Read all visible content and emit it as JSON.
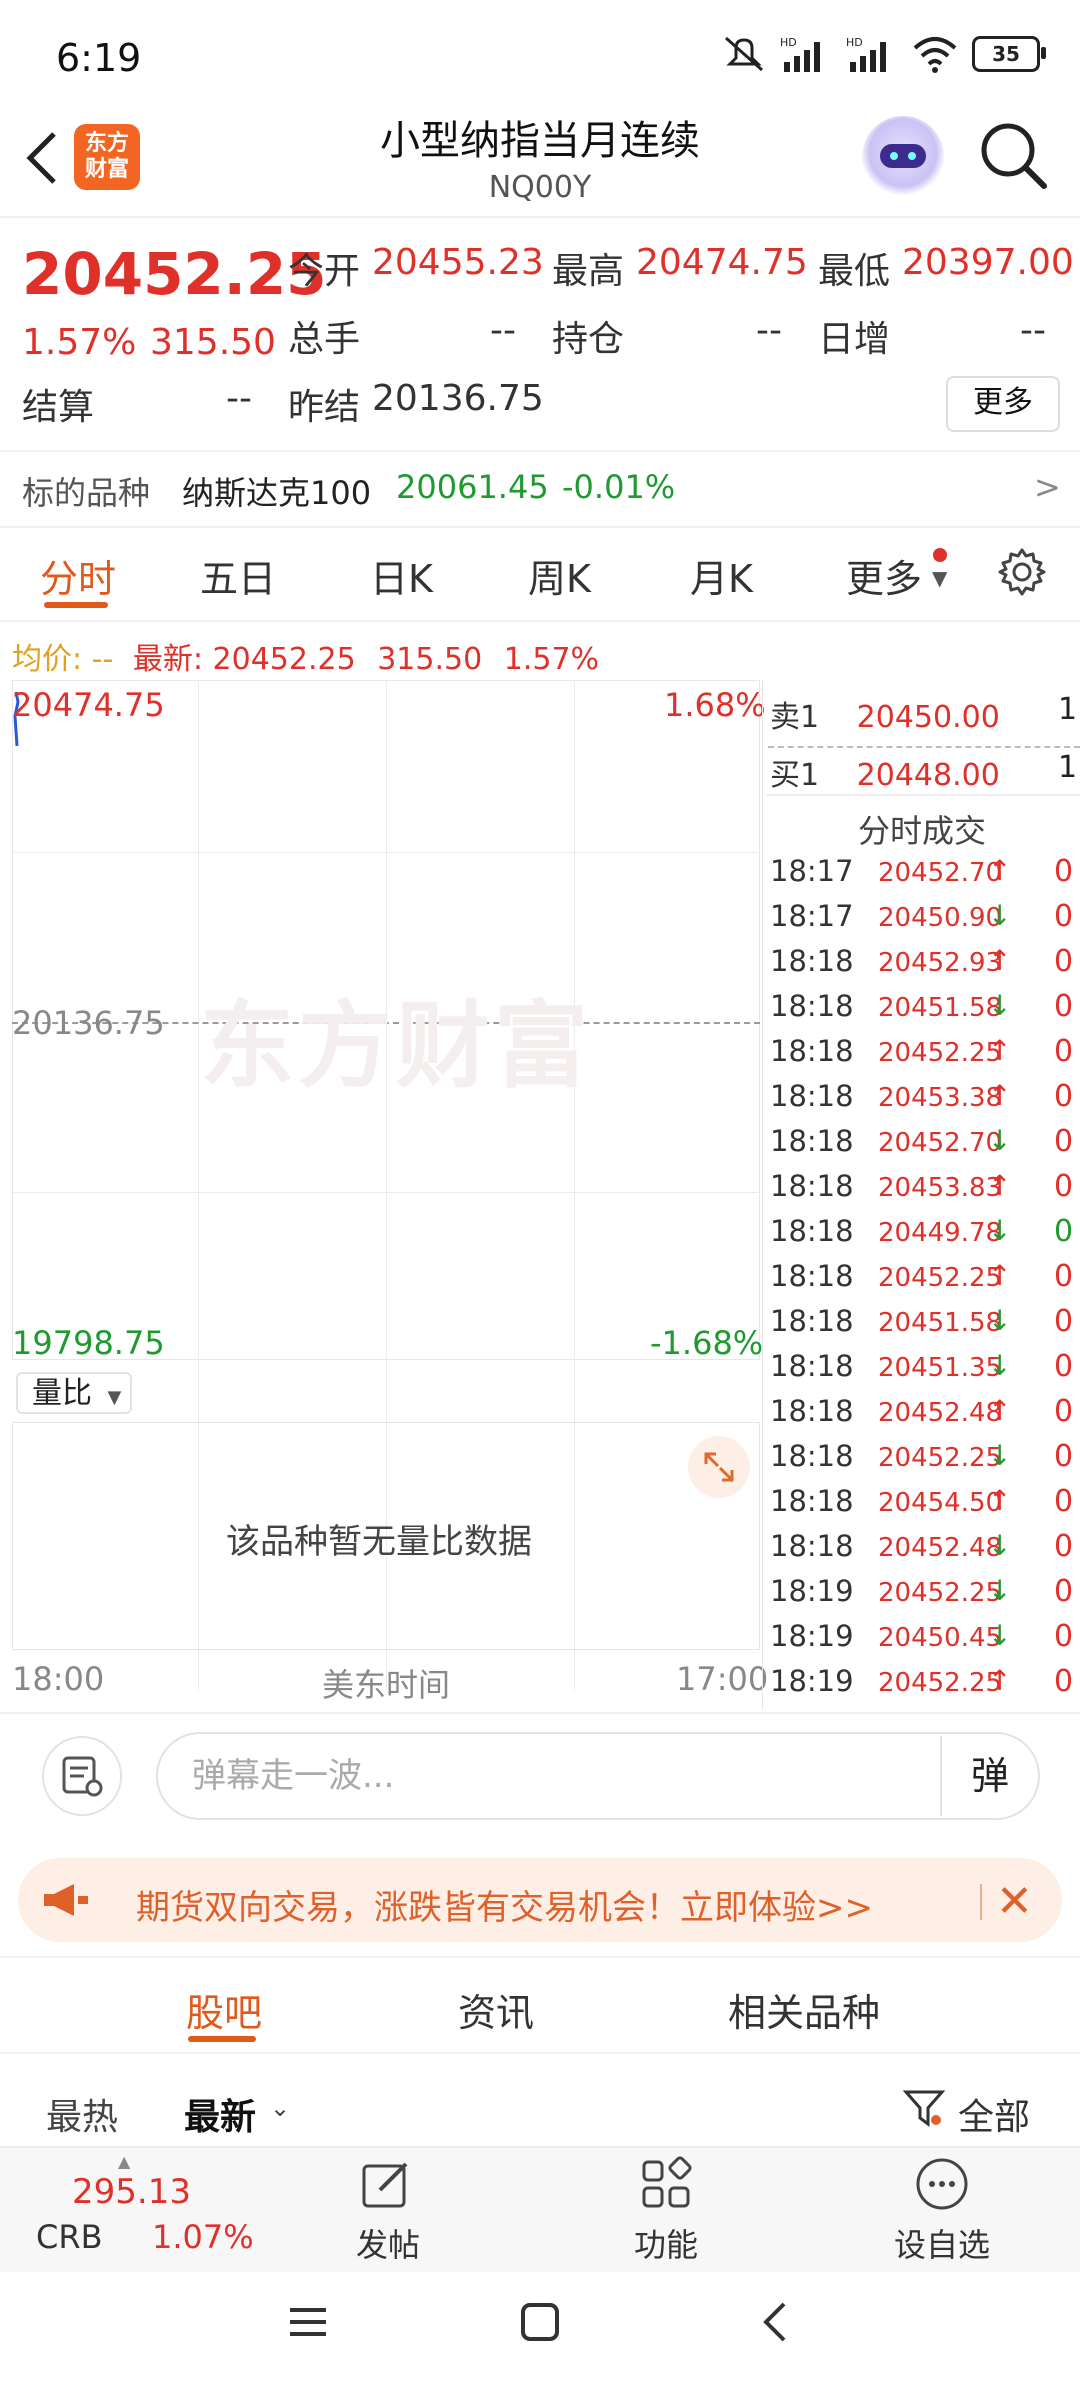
{
  "status": {
    "time": "6:19",
    "battery": "35"
  },
  "header": {
    "title": "小型纳指当月连续",
    "code": "NQ00Y",
    "logo_line1": "东方",
    "logo_line2": "财富"
  },
  "quote": {
    "price": "20452.25",
    "pct": "1.57%",
    "change": "315.50",
    "open_label": "今开",
    "open": "20455.23",
    "high_label": "最高",
    "high": "20474.75",
    "low_label": "最低",
    "low": "20397.00",
    "volume_label": "总手",
    "volume": "--",
    "oi_label": "持仓",
    "oi": "--",
    "daily_inc_label": "日增",
    "daily_inc": "--",
    "settle_label": "结算",
    "settle": "--",
    "prev_settle_label": "昨结",
    "prev_settle": "20136.75",
    "more_label": "更多"
  },
  "underlying": {
    "label": "标的品种",
    "name": "纳斯达克100",
    "price": "20061.45",
    "pct": "-0.01%",
    "arrow": ">"
  },
  "tabs": [
    "分时",
    "五日",
    "日K",
    "周K",
    "月K",
    "更多"
  ],
  "avg": {
    "avg_label": "均价:",
    "avg_val": "--",
    "latest_label": "最新:",
    "latest": "20452.25",
    "change": "315.50",
    "pct": "1.57%"
  },
  "chart": {
    "high": "20474.75",
    "high_pct": "1.68%",
    "mid": "20136.75",
    "low": "19798.75",
    "low_pct": "-1.68%",
    "watermark": "东方财富",
    "start_time": "18:00",
    "mid_time": "美东时间",
    "end_time": "17:00",
    "volume_select": "量比",
    "no_data": "该品种暂无量比数据"
  },
  "orderbook": {
    "sell_label": "卖1",
    "sell_price": "20450.00",
    "sell_vol": "1",
    "buy_label": "买1",
    "buy_price": "20448.00",
    "buy_vol": "1",
    "trades_title": "分时成交"
  },
  "trades": [
    {
      "time": "18:17",
      "price": "20452.70",
      "dir": "up",
      "vol": "0"
    },
    {
      "time": "18:17",
      "price": "20450.90",
      "dir": "down",
      "vol": "0"
    },
    {
      "time": "18:18",
      "price": "20452.93",
      "dir": "up",
      "vol": "0"
    },
    {
      "time": "18:18",
      "price": "20451.58",
      "dir": "down",
      "vol": "0"
    },
    {
      "time": "18:18",
      "price": "20452.25",
      "dir": "up",
      "vol": "0"
    },
    {
      "time": "18:18",
      "price": "20453.38",
      "dir": "up",
      "vol": "0"
    },
    {
      "time": "18:18",
      "price": "20452.70",
      "dir": "down",
      "vol": "0"
    },
    {
      "time": "18:18",
      "price": "20453.83",
      "dir": "up",
      "vol": "0"
    },
    {
      "time": "18:18",
      "price": "20449.78",
      "dir": "down",
      "vol": "0"
    },
    {
      "time": "18:18",
      "price": "20452.25",
      "dir": "up",
      "vol": "0"
    },
    {
      "time": "18:18",
      "price": "20451.58",
      "dir": "down",
      "vol": "0"
    },
    {
      "time": "18:18",
      "price": "20451.35",
      "dir": "down",
      "vol": "0"
    },
    {
      "time": "18:18",
      "price": "20452.48",
      "dir": "up",
      "vol": "0"
    },
    {
      "time": "18:18",
      "price": "20452.25",
      "dir": "down",
      "vol": "0"
    },
    {
      "time": "18:18",
      "price": "20454.50",
      "dir": "up",
      "vol": "0"
    },
    {
      "time": "18:18",
      "price": "20452.48",
      "dir": "down",
      "vol": "0"
    },
    {
      "time": "18:19",
      "price": "20452.25",
      "dir": "down",
      "vol": "0"
    },
    {
      "time": "18:19",
      "price": "20450.45",
      "dir": "down",
      "vol": "0"
    },
    {
      "time": "18:19",
      "price": "20452.25",
      "dir": "up",
      "vol": "0"
    }
  ],
  "input": {
    "placeholder": "弹幕走一波...",
    "danmu_label": "弹"
  },
  "banner": {
    "text": "期货双向交易，涨跌皆有交易机会！立即体验>>"
  },
  "sub_tabs": [
    "股吧",
    "资讯",
    "相关品种"
  ],
  "sort": {
    "hot": "最热",
    "latest": "最新",
    "filter": "全部"
  },
  "bottom_nav": {
    "crb_value": "295.13",
    "crb_label": "CRB",
    "crb_pct": "1.07%",
    "post": "发帖",
    "func": "功能",
    "watch": "设自选"
  }
}
